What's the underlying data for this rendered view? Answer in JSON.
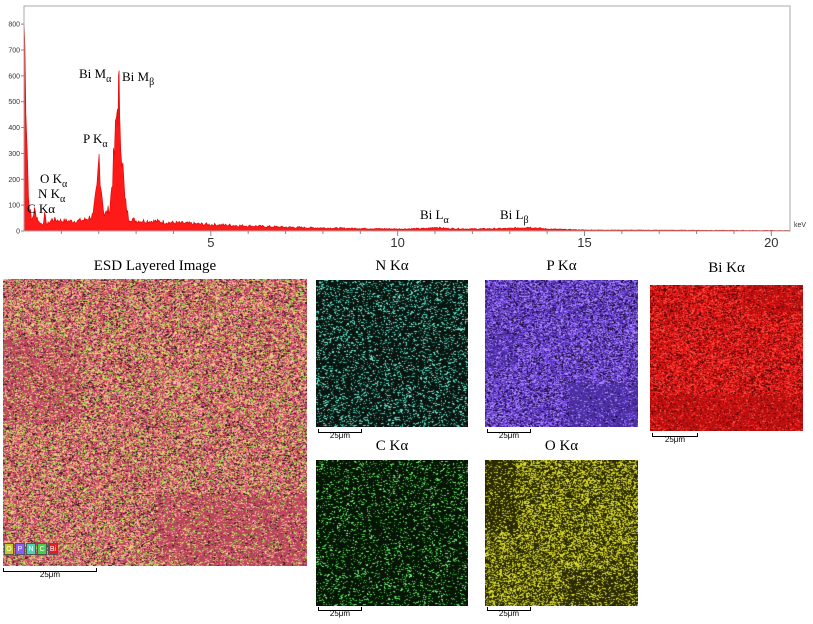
{
  "chart_data": {
    "type": "area",
    "xlabel": "keV",
    "xlim": [
      0,
      20.5
    ],
    "ylim": [
      0,
      870
    ],
    "x_ticks": [
      "5",
      "10",
      "15",
      "20"
    ],
    "y_ticks": [
      "0",
      "100",
      "200",
      "300",
      "400",
      "500",
      "600",
      "700",
      "800"
    ],
    "color": "#ff1a1a",
    "series": [
      {
        "x": [
          0.0,
          0.05,
          0.12,
          0.2,
          0.28,
          0.4,
          0.5,
          0.55,
          0.62,
          0.75,
          1.0,
          1.3,
          1.6,
          1.85,
          1.95,
          2.01,
          2.07,
          2.15,
          2.3,
          2.42,
          2.5,
          2.53,
          2.56,
          2.62,
          2.7,
          2.8,
          3.0,
          3.5,
          4.0,
          5.0,
          6.0,
          7.0,
          8.0,
          9.0,
          10.0,
          10.8,
          11.0,
          11.3,
          12.0,
          13.0,
          13.5,
          14.0,
          15.0,
          20.5
        ],
        "y": [
          830,
          560,
          130,
          40,
          80,
          35,
          25,
          60,
          25,
          45,
          40,
          38,
          42,
          60,
          160,
          290,
          170,
          60,
          90,
          300,
          480,
          525,
          510,
          300,
          120,
          50,
          40,
          38,
          32,
          25,
          20,
          15,
          12,
          10,
          8,
          10,
          15,
          10,
          8,
          10,
          15,
          8,
          4,
          2
        ]
      }
    ],
    "peak_labels": [
      {
        "main": "Bi M",
        "sub": "α",
        "x": 2.45
      },
      {
        "main": "Bi M",
        "sub": "β",
        "x": 3.55
      },
      {
        "main": "P K",
        "sub": "α",
        "x": 2.05
      },
      {
        "main": "O K",
        "sub": "α",
        "x": 0.55
      },
      {
        "main": "N K",
        "sub": "α",
        "x": 0.5
      },
      {
        "main": "C Kα",
        "sub": "",
        "x": 0.3
      },
      {
        "main": "Bi L",
        "sub": "α",
        "x": 11.0
      },
      {
        "main": "Bi L",
        "sub": "β",
        "x": 13.3
      }
    ]
  },
  "maps": {
    "layered": {
      "title": "ESD Layered Image",
      "scale": "25μm",
      "base": "#b8465a",
      "dots": [
        "#f6b0a8",
        "#f08070",
        "#d94080",
        "#8fd04a",
        "#e8e070",
        "#3b1820"
      ]
    },
    "n": {
      "title": "N Kα",
      "scale": "25μm",
      "base": "#0b1510",
      "dots": [
        "#4fd1b6",
        "#2a8f7c",
        "#7fe8d0"
      ]
    },
    "p": {
      "title": "P Kα",
      "scale": "25μm",
      "base": "#4b2fa0",
      "dots": [
        "#8a5cf5",
        "#6a40d8",
        "#b08cff",
        "#1a0d3a"
      ]
    },
    "bi": {
      "title": "Bi Kα",
      "scale": "25μm",
      "base": "#b80f0f",
      "dots": [
        "#ff2020",
        "#e01515",
        "#5a0505",
        "#ff5040"
      ]
    },
    "c": {
      "title": "C Kα",
      "scale": "25μm",
      "base": "#061506",
      "dots": [
        "#4dc94d",
        "#2e8a2e",
        "#7ff07f"
      ]
    },
    "o": {
      "title": "O Kα",
      "scale": "25μm",
      "base": "#2a2a05",
      "dots": [
        "#c8c820",
        "#e2e23a",
        "#8a8a10"
      ]
    }
  },
  "legend_swatches": [
    {
      "label": "O",
      "color": "#c8c820"
    },
    {
      "label": "P",
      "color": "#8a5cf5"
    },
    {
      "label": "N",
      "color": "#4fd1b6"
    },
    {
      "label": "C",
      "color": "#4dc94d"
    },
    {
      "label": "Bi",
      "color": "#e02020"
    }
  ]
}
